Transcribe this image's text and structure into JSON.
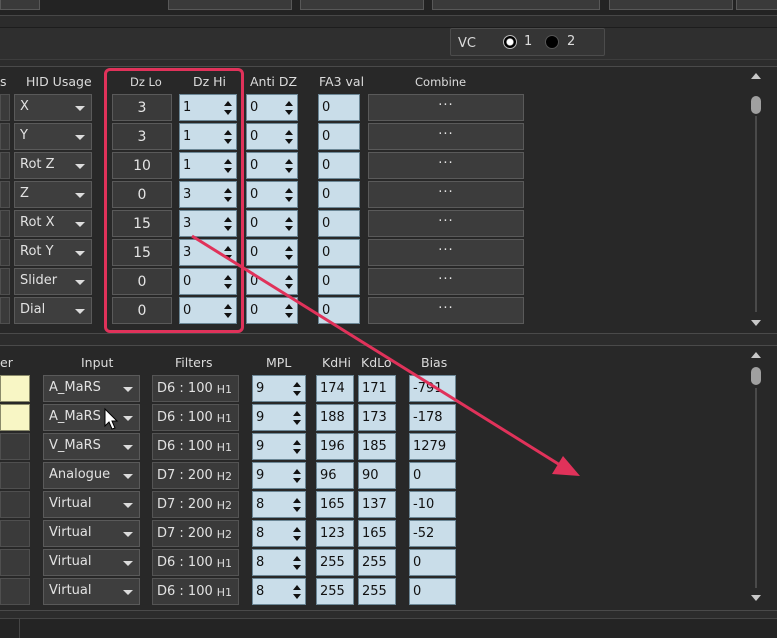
{
  "vc": {
    "label": "VC",
    "options": [
      "1",
      "2"
    ],
    "selected": "1"
  },
  "axes": {
    "headers": {
      "hid_usage": "HID Usage",
      "dz_lo": "Dz Lo",
      "dz_hi": "Dz Hi",
      "anti_dz": "Anti DZ",
      "fa3_val": "FA3 val",
      "combine": "Combine",
      "partial": "s"
    },
    "rows": [
      {
        "hid": "X",
        "dz_lo": "3",
        "dz_hi": "1",
        "anti_dz": "0",
        "fa3": "0",
        "combine": "···"
      },
      {
        "hid": "Y",
        "dz_lo": "3",
        "dz_hi": "1",
        "anti_dz": "0",
        "fa3": "0",
        "combine": "···"
      },
      {
        "hid": "Rot Z",
        "dz_lo": "10",
        "dz_hi": "1",
        "anti_dz": "0",
        "fa3": "0",
        "combine": "···"
      },
      {
        "hid": "Z",
        "dz_lo": "0",
        "dz_hi": "3",
        "anti_dz": "0",
        "fa3": "0",
        "combine": "···"
      },
      {
        "hid": "Rot X",
        "dz_lo": "15",
        "dz_hi": "3",
        "anti_dz": "0",
        "fa3": "0",
        "combine": "···"
      },
      {
        "hid": "Rot Y",
        "dz_lo": "15",
        "dz_hi": "3",
        "anti_dz": "0",
        "fa3": "0",
        "combine": "···"
      },
      {
        "hid": "Slider",
        "dz_lo": "0",
        "dz_hi": "0",
        "anti_dz": "0",
        "fa3": "0",
        "combine": "···"
      },
      {
        "hid": "Dial",
        "dz_lo": "0",
        "dz_hi": "0",
        "anti_dz": "0",
        "fa3": "0",
        "combine": "···"
      }
    ]
  },
  "filters": {
    "headers": {
      "partial": "er",
      "input": "Input",
      "filters": "Filters",
      "mpl": "MPL",
      "kdhi": "KdHi",
      "kdlo": "KdLo",
      "bias": "Bias"
    },
    "rows": [
      {
        "input": "A_MaRS",
        "filter": "D6 : 100",
        "h": "H1",
        "mpl": "9",
        "kdhi": "174",
        "kdlo": "171",
        "bias": "-791"
      },
      {
        "input": "A_MaRS",
        "filter": "D6 : 100",
        "h": "H1",
        "mpl": "9",
        "kdhi": "188",
        "kdlo": "173",
        "bias": "-178"
      },
      {
        "input": "V_MaRS",
        "filter": "D6 : 100",
        "h": "H1",
        "mpl": "9",
        "kdhi": "196",
        "kdlo": "185",
        "bias": "1279"
      },
      {
        "input": "Analogue",
        "filter": "D7 : 200",
        "h": "H2",
        "mpl": "9",
        "kdhi": "96",
        "kdlo": "90",
        "bias": "0"
      },
      {
        "input": "Virtual",
        "filter": "D7 : 200",
        "h": "H2",
        "mpl": "8",
        "kdhi": "165",
        "kdlo": "137",
        "bias": "-10"
      },
      {
        "input": "Virtual",
        "filter": "D7 : 200",
        "h": "H2",
        "mpl": "8",
        "kdhi": "123",
        "kdlo": "165",
        "bias": "-52"
      },
      {
        "input": "Virtual",
        "filter": "D6 : 100",
        "h": "H1",
        "mpl": "8",
        "kdhi": "255",
        "kdlo": "255",
        "bias": "0"
      },
      {
        "input": "Virtual",
        "filter": "D6 : 100",
        "h": "H1",
        "mpl": "8",
        "kdhi": "255",
        "kdlo": "255",
        "bias": "0"
      }
    ]
  },
  "colors": {
    "highlight": "#e0325a",
    "field": "#c9dde9",
    "yellow_field": "#f8f6c5"
  }
}
